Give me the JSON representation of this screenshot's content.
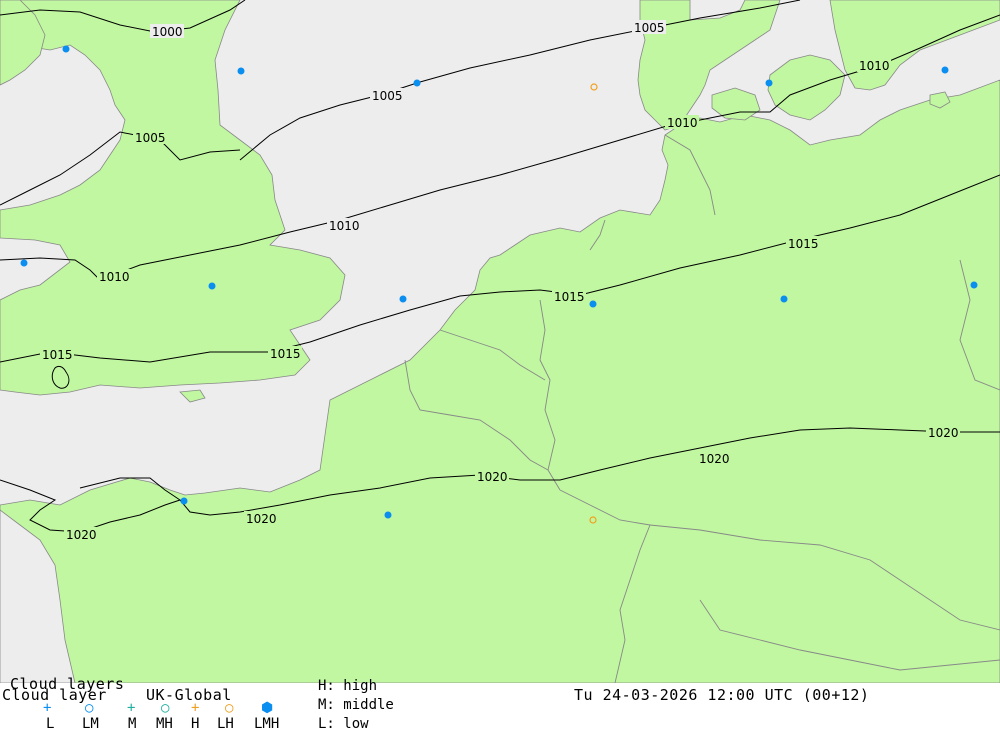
{
  "map": {
    "colors": {
      "sea": "#ededed",
      "land": "#c0f7a0",
      "border": "#888888",
      "isobar": "#000000",
      "marker_lmh": "#0a8ef0",
      "marker_high": "#f0a020"
    },
    "isobar_labels": [
      "1000",
      "1005",
      "1010",
      "1015",
      "1020"
    ],
    "cloud_markers": [
      {
        "type": "LMH"
      },
      {
        "type": "LMH"
      },
      {
        "type": "LMH"
      },
      {
        "type": "LMH"
      },
      {
        "type": "LMH"
      },
      {
        "type": "LMH"
      },
      {
        "type": "LMH"
      },
      {
        "type": "LMH"
      },
      {
        "type": "LMH"
      },
      {
        "type": "LMH"
      },
      {
        "type": "LMH"
      },
      {
        "type": "LMH"
      },
      {
        "type": "LMH"
      },
      {
        "type": "H"
      },
      {
        "type": "H"
      }
    ]
  },
  "legend": {
    "title_behind": "Cloud layers",
    "title_front": "Cloud layer",
    "model": "UK-Global",
    "symbols": [
      "+",
      "○",
      "+",
      "○",
      "+",
      "○",
      "⬢"
    ],
    "labels": [
      "L",
      "LM",
      "M",
      "MH",
      "H",
      "LH",
      "LMH"
    ],
    "key_high": "H: high",
    "key_middle": "M: middle",
    "key_low": "L: low",
    "datetime": "Tu 24-03-2026 12:00 UTC (00+12)"
  }
}
